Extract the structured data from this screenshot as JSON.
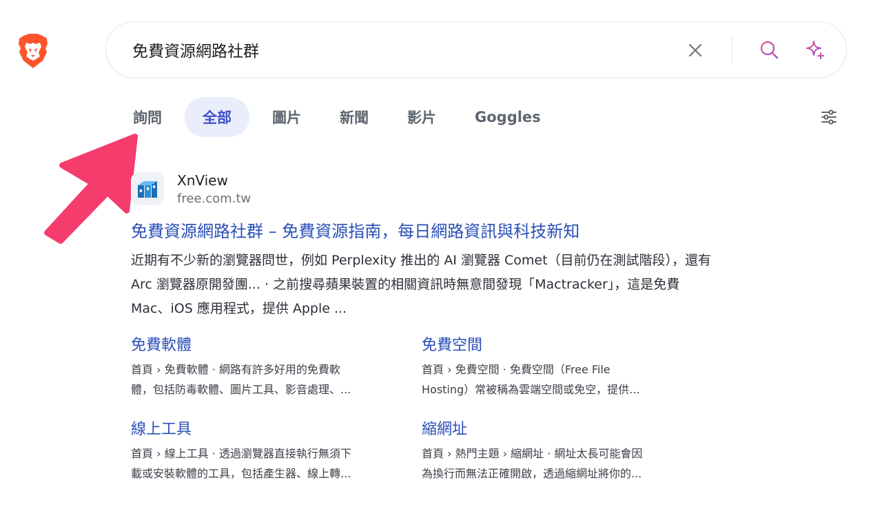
{
  "search": {
    "query": "免費資源網路社群"
  },
  "tabs": [
    {
      "label": "詢問",
      "active": false
    },
    {
      "label": "全部",
      "active": true
    },
    {
      "label": "圖片",
      "active": false
    },
    {
      "label": "新聞",
      "active": false
    },
    {
      "label": "影片",
      "active": false
    },
    {
      "label": "Goggles",
      "active": false
    }
  ],
  "icons": {
    "logo": "brave-lion-logo",
    "clear": "close-icon",
    "search": "search-icon",
    "ai": "sparkle-icon",
    "filter": "sliders-icon",
    "annotation": "pink-arrow-annotation"
  },
  "colors": {
    "accent": "#3f51c7",
    "link": "#2a4fb8",
    "arrow": "#f43d6d",
    "brave_orange": "#fb542b"
  },
  "result": {
    "site_name": "XnView",
    "site_url": "free.com.tw",
    "title": "免費資源網路社群 – 免費資源指南，每日網路資訊與科技新知",
    "snippet_lines": [
      "近期有不少新的瀏覽器問世，例如 Perplexity 推出的 AI 瀏覽器 Comet（目前仍在測試階段），還有",
      "Arc 瀏覽器原開發團... · 之前搜尋蘋果裝置的相關資訊時無意間發現「Mactracker」，這是免費",
      "Mac、iOS 應用程式，提供 Apple ..."
    ],
    "sitelinks": [
      {
        "title": "免費軟體",
        "desc_lines": [
          "首頁 › 免費軟體 · 網路有許多好用的免費軟",
          "體，包括防毒軟體、圖片工具、影音處理、..."
        ]
      },
      {
        "title": "免費空間",
        "desc_lines": [
          "首頁 › 免費空間 · 免費空間（Free File",
          "Hosting）常被稱為雲端空間或免空，提供..."
        ]
      },
      {
        "title": "線上工具",
        "desc_lines": [
          "首頁 › 線上工具 · 透過瀏覽器直接執行無須下",
          "載或安裝軟體的工具，包括產生器、線上轉..."
        ]
      },
      {
        "title": "縮網址",
        "desc_lines": [
          "首頁 › 熱門主題 › 縮網址 · 網址太長可能會因",
          "為換行而無法正確開啟，透過縮網址將你的..."
        ]
      }
    ]
  }
}
